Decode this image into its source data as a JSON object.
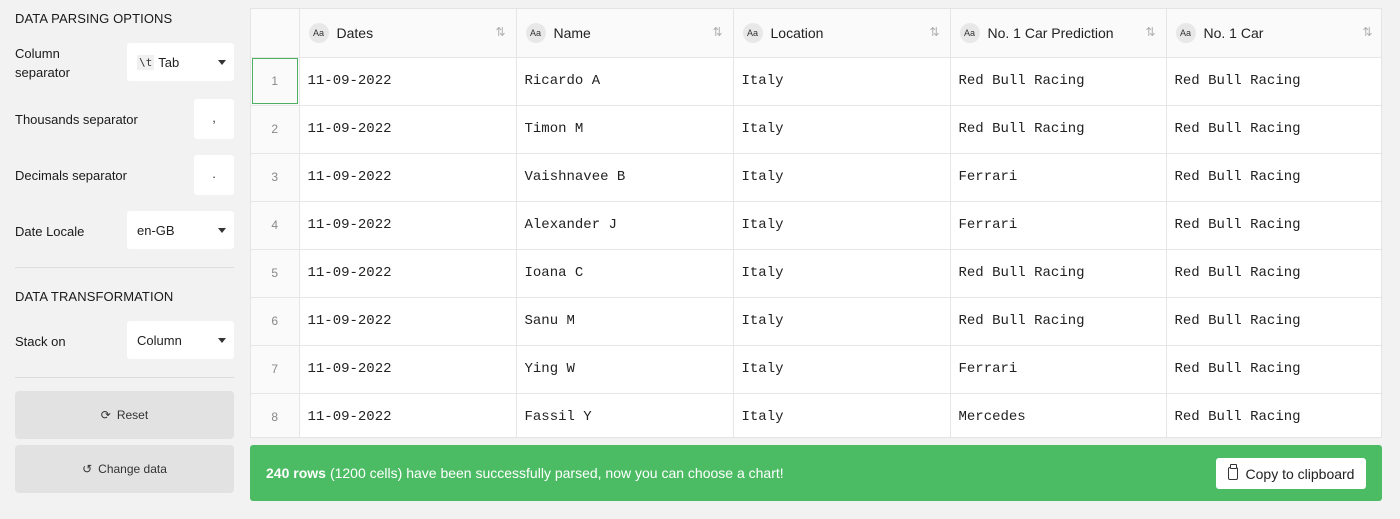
{
  "parsing": {
    "title": "DATA PARSING OPTIONS",
    "column_separator_label": "Column separator",
    "column_separator_code": "\\t",
    "column_separator_value": "Tab",
    "thousands_label": "Thousands separator",
    "thousands_value": ",",
    "decimals_label": "Decimals separator",
    "decimals_value": ".",
    "date_locale_label": "Date Locale",
    "date_locale_value": "en-GB"
  },
  "transformation": {
    "title": "DATA TRANSFORMATION",
    "stack_on_label": "Stack on",
    "stack_on_value": "Column"
  },
  "actions": {
    "reset_label": "Reset",
    "change_data_label": "Change data"
  },
  "table": {
    "type_badge": "Aa",
    "columns": [
      "Dates",
      "Name",
      "Location",
      "No. 1 Car Prediction",
      "No. 1 Car"
    ],
    "rows": [
      {
        "index": "1",
        "cells": [
          "11-09-2022",
          "Ricardo A",
          "Italy",
          "Red Bull Racing",
          "Red Bull Racing"
        ]
      },
      {
        "index": "2",
        "cells": [
          "11-09-2022",
          "Timon M",
          "Italy",
          "Red Bull Racing",
          "Red Bull Racing"
        ]
      },
      {
        "index": "3",
        "cells": [
          "11-09-2022",
          "Vaishnavee B",
          "Italy",
          "Ferrari",
          "Red Bull Racing"
        ]
      },
      {
        "index": "4",
        "cells": [
          "11-09-2022",
          "Alexander J",
          "Italy",
          "Ferrari",
          "Red Bull Racing"
        ]
      },
      {
        "index": "5",
        "cells": [
          "11-09-2022",
          "Ioana C",
          "Italy",
          "Red Bull Racing",
          "Red Bull Racing"
        ]
      },
      {
        "index": "6",
        "cells": [
          "11-09-2022",
          "Sanu M",
          "Italy",
          "Red Bull Racing",
          "Red Bull Racing"
        ]
      },
      {
        "index": "7",
        "cells": [
          "11-09-2022",
          "Ying W",
          "Italy",
          "Ferrari",
          "Red Bull Racing"
        ]
      },
      {
        "index": "8",
        "cells": [
          "11-09-2022",
          "Fassil Y",
          "Italy",
          "Mercedes",
          "Red Bull Racing"
        ]
      }
    ]
  },
  "status": {
    "rows_bold": "240 rows",
    "message": "(1200 cells) have been successfully parsed, now you can choose a chart!",
    "copy_label": "Copy to clipboard",
    "color": "#4cbc64"
  }
}
